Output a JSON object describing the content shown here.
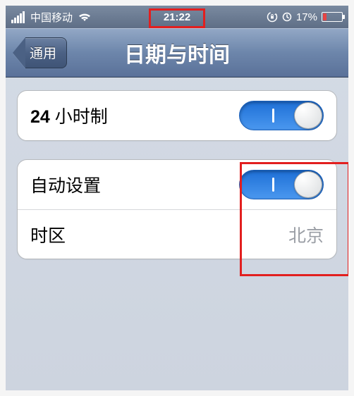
{
  "status_bar": {
    "carrier": "中国移动",
    "time": "21:22",
    "battery_percent": "17%"
  },
  "nav": {
    "back_label": "通用",
    "title": "日期与时间"
  },
  "group1": {
    "hour24_prefix": "24",
    "hour24_suffix": " 小时制"
  },
  "group2": {
    "auto_set_label": "自动设置",
    "timezone_label": "时区",
    "timezone_value": "北京"
  }
}
